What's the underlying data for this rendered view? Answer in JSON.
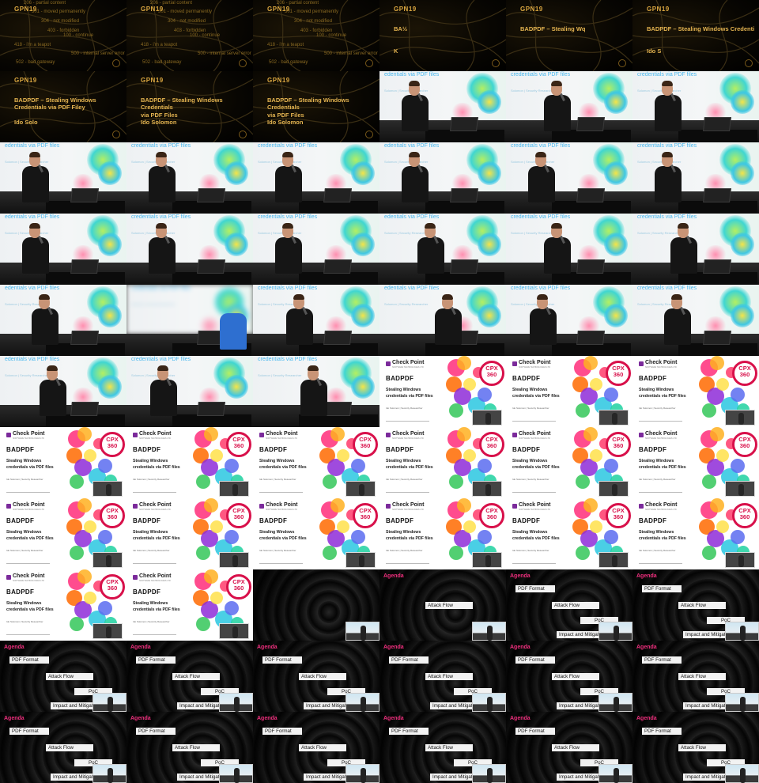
{
  "grid": {
    "columns": 6,
    "rows": 11
  },
  "intro": {
    "event": "GPN19",
    "status_codes": [
      "206 - partial content",
      "301 - moved permanently",
      "304 - not modified",
      "403 - forbidden",
      "100 - continue",
      "418 - i'm a teapot",
      "500 - internal server error",
      "502 - bad gateway"
    ],
    "title_full": "BADPDF – Stealing Windows Credentials via PDF Files",
    "title_lines_a": [
      "BADPDF – Stealing Windows Credentials",
      "via PDF Files"
    ],
    "author": "Ido Solomon",
    "title_partial_1": "BA½",
    "title_partial_2": "K",
    "title_partial_3": "BADPDF – Stealing Wq",
    "title_partial_4": "BADPDF – Stealing Windows Credenti",
    "author_partial_1": "Ido S",
    "author_partial_2": "Ido Solo",
    "title_partial_5": "BADPDF – Stealing Windows Credentials via PDF Filey"
  },
  "stage": {
    "slide_title": "credentials via PDF files",
    "slide_title_short": "edentials via PDF files",
    "slide_subtitle": "Solomon | Security Researcher"
  },
  "checkpoint": {
    "brand": "Check Point",
    "tagline": "SOFTWARE TECHNOLOGIES LTD",
    "badge_line1": "CPX",
    "badge_line2": "360",
    "heading": "BADPDF",
    "subtitle": "Stealing Windows credentials via PDF files",
    "author_line": "Ido Solomon | Security Researcher"
  },
  "agenda": {
    "heading": "Agenda",
    "items": [
      "PDF Format",
      "Attack Flow",
      "PoC",
      "Impact and Mitigation"
    ]
  },
  "colors": {
    "gold": "#e3b350",
    "agenda_pink": "#ee2f7d",
    "cpx_red": "#d8104a",
    "slide_blue": "#4ab8ee"
  }
}
